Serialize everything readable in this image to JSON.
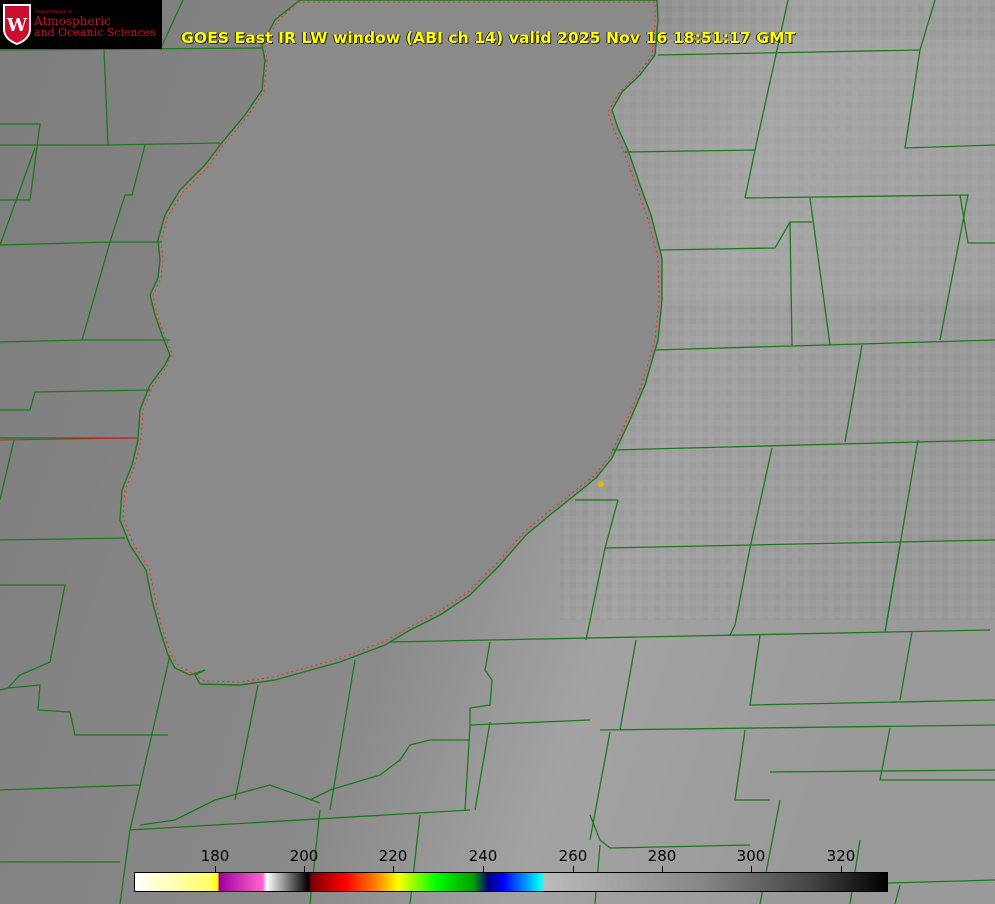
{
  "title": "GOES East IR LW window (ABI ch 14) valid 2025 Nov 16 18:51:17 GMT",
  "logo": {
    "department": "Department of",
    "line1": "Atmospheric",
    "line2": "and Oceanic Sciences",
    "seal_letter": "W"
  },
  "colorbar": {
    "ticks": [
      "180",
      "200",
      "220",
      "240",
      "260",
      "280",
      "300",
      "320"
    ]
  },
  "colors": {
    "boundary": "#1a7a1a",
    "coast_dotted": "#ff2222",
    "title": "#ffff00",
    "marker": "#d4c000"
  }
}
